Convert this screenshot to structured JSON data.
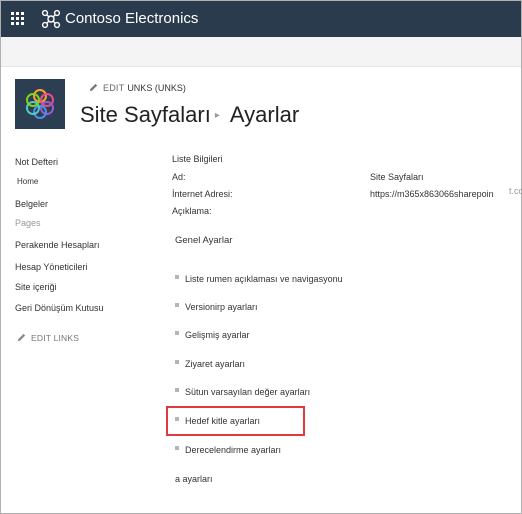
{
  "suite": {
    "brand_name": "Contoso Electronics",
    "waffle_icon": "app-launcher-icon",
    "brand_icon": "contoso-logo-icon",
    "bar_color": "#2a3b4d"
  },
  "header": {
    "edit_label": "EDIT",
    "site_tag": "UNKS (UNKS)",
    "site_title": "Site Sayfaları",
    "page_title": "Ayarlar"
  },
  "leftnav": {
    "items": [
      {
        "label": "Not Defteri"
      },
      {
        "label": "Home"
      },
      {
        "label": "Belgeler"
      },
      {
        "label": "Pages"
      },
      {
        "label": "Perakende Hesapları"
      },
      {
        "label": "Hesap Yöneticileri"
      },
      {
        "label": "Site içeriği"
      },
      {
        "label": "Geri Dönüşüm Kutusu"
      }
    ],
    "edit_links": "EDIT LINKS"
  },
  "list_info": {
    "heading": "Liste Bilgileri",
    "name_label": "Ad:",
    "name_value": "Site Sayfaları",
    "address_label": "İnternet Adresi:",
    "address_value": "https://m365x863066sharepoin",
    "address_overflow": "t.co",
    "description_label": "Açıklama:"
  },
  "general_settings": {
    "heading": "Genel Ayarlar",
    "items": [
      {
        "label": "Liste rumen açıklaması ve navigasyonu"
      },
      {
        "label": "Versionirp ayarları"
      },
      {
        "label": "Gelişmiş ayarlar"
      },
      {
        "label": "Ziyaret ayarları"
      },
      {
        "label": "Sütun varsayılan değer ayarları"
      },
      {
        "label": "Hedef kitle ayarları"
      },
      {
        "label": "Derecelendirme ayarları"
      }
    ],
    "trailing_link": "a ayarları"
  },
  "colors": {
    "highlight": "#e0393e"
  }
}
